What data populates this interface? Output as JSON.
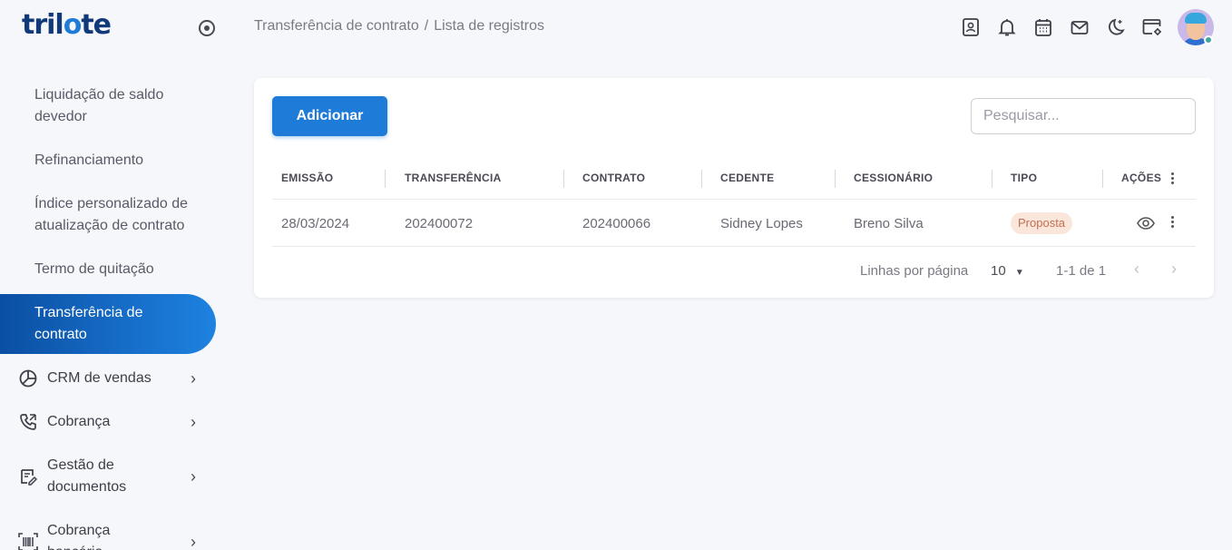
{
  "brand": {
    "logo_text_a": "tril",
    "logo_text_b": "o",
    "logo_text_c": "te"
  },
  "sidebar": {
    "items": [
      {
        "label": "Liquidação de saldo devedor"
      },
      {
        "label": "Refinanciamento"
      },
      {
        "label": "Índice personalizado de atualização de contrato"
      },
      {
        "label": "Termo de quitação"
      },
      {
        "label": "Transferência de contrato",
        "active": true
      }
    ],
    "groups": [
      {
        "label": "CRM de vendas",
        "icon": "pie-chart-icon"
      },
      {
        "label": "Cobrança",
        "icon": "phone-icon"
      },
      {
        "label": "Gestão de documentos",
        "icon": "document-edit-icon"
      },
      {
        "label": "Cobrança bancária",
        "icon": "barcode-icon"
      }
    ]
  },
  "breadcrumb": {
    "first": "Transferência de contrato",
    "separator": "/",
    "current": "Lista de registros"
  },
  "topbar": {
    "icons": [
      "contacts-icon",
      "bell-icon",
      "calendar-icon",
      "mail-icon",
      "dark-mode-icon",
      "browser-settings-icon"
    ]
  },
  "toolbar": {
    "add_label": "Adicionar",
    "search_placeholder": "Pesquisar..."
  },
  "table": {
    "headers": [
      "EMISSÃO",
      "TRANSFERÊNCIA",
      "CONTRATO",
      "CEDENTE",
      "CESSIONÁRIO",
      "TIPO",
      "AÇÕES"
    ],
    "rows": [
      {
        "emissao": "28/03/2024",
        "transferencia": "202400072",
        "contrato": "202400066",
        "cedente": "Sidney Lopes",
        "cessionario": "Breno Silva",
        "tipo": "Proposta"
      }
    ]
  },
  "pagination": {
    "rows_label": "Linhas por página",
    "rows_value": "10",
    "range": "1-1 de 1"
  },
  "colors": {
    "primary": "#1f7bd8",
    "brand": "#123a7a",
    "badge_bg": "#fbe6dc",
    "badge_text": "#c07050"
  }
}
